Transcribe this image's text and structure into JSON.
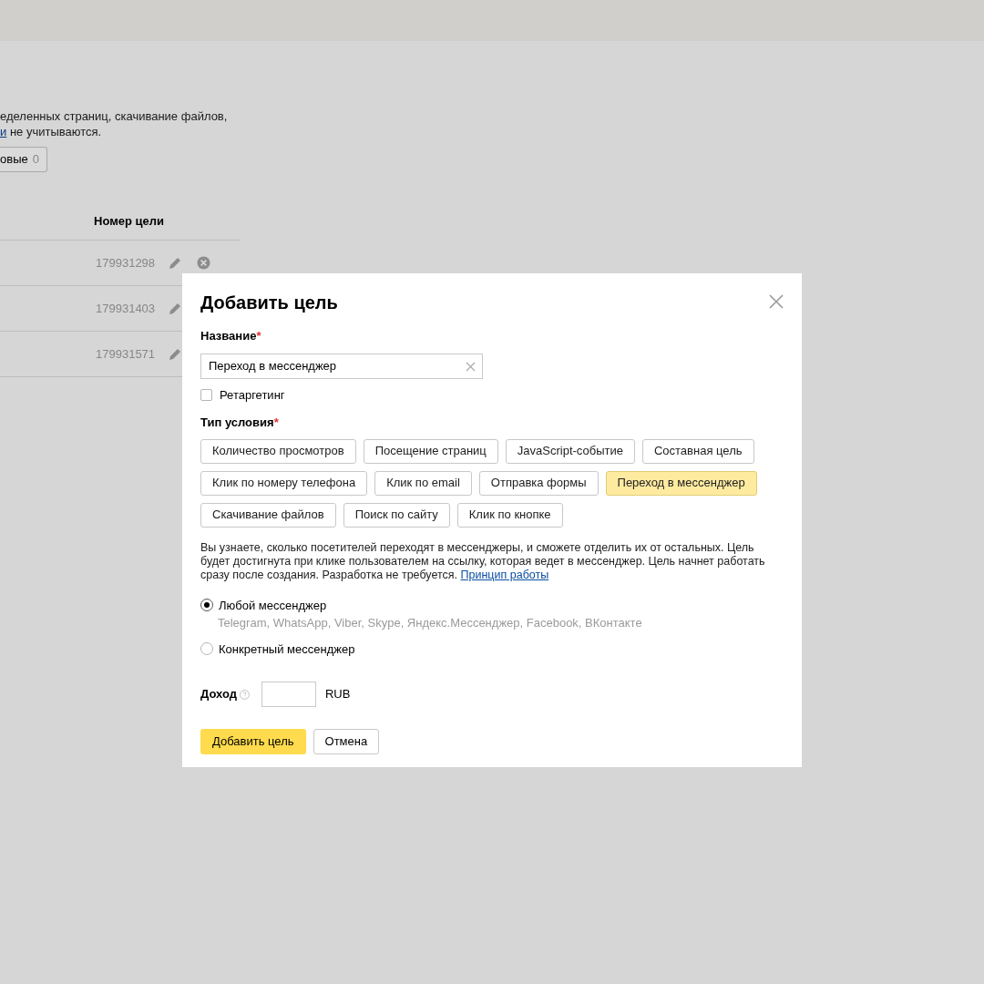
{
  "background": {
    "intro_line_1": "еделенных страниц, скачивание файлов,",
    "intro_line_2": {
      "link": "и",
      "text": "не учитываются."
    },
    "filter_button": {
      "label": "овые",
      "count": "0"
    },
    "table": {
      "columns": [
        "Номер цели"
      ],
      "rows": [
        {
          "goal_number": "179931298",
          "delete_icon": true
        },
        {
          "goal_number": "179931403"
        },
        {
          "goal_number": "179931571"
        }
      ]
    }
  },
  "dialog": {
    "title": "Добавить цель",
    "name_label": "Название",
    "required_mark": "*",
    "name_value": "Переход в мессенджер",
    "retargeting": {
      "label": "Ретаргетинг",
      "checked": false
    },
    "condition_label": "Тип условия",
    "condition_types": [
      {
        "label": "Количество просмотров",
        "selected": false
      },
      {
        "label": "Посещение страниц",
        "selected": false
      },
      {
        "label": "JavaScript-событие",
        "selected": false
      },
      {
        "label": "Составная цель",
        "selected": false
      },
      {
        "label": "Клик по номеру телефона",
        "selected": false
      },
      {
        "label": "Клик по email",
        "selected": false
      },
      {
        "label": "Отправка формы",
        "selected": false
      },
      {
        "label": "Переход в мессенджер",
        "selected": true
      },
      {
        "label": "Скачивание файлов",
        "selected": false
      },
      {
        "label": "Поиск по сайту",
        "selected": false
      },
      {
        "label": "Клик по кнопке",
        "selected": false
      }
    ],
    "description": "Вы узнаете, сколько посетителей переходят в мессенджеры, и сможете отделить их от остальных. Цель будет достигнута при клике пользователем на ссылку, которая ведет в мессенджер. Цель начнет работать сразу после создания. Разработка не требуется.",
    "description_link": "Принцип работы",
    "messenger_options": [
      {
        "label": "Любой мессенджер",
        "hint": "Telegram, WhatsApp, Viber, Skype, Яндекс.Мессенджер, Facebook, ВКонтакте",
        "selected": true
      },
      {
        "label": "Конкретный мессенджер",
        "selected": false
      }
    ],
    "revenue_label": "Доход",
    "currency": "RUB",
    "buttons": [
      {
        "label": "Добавить цель",
        "kind": "primary"
      },
      {
        "label": "Отмена",
        "kind": "secondary"
      }
    ]
  }
}
